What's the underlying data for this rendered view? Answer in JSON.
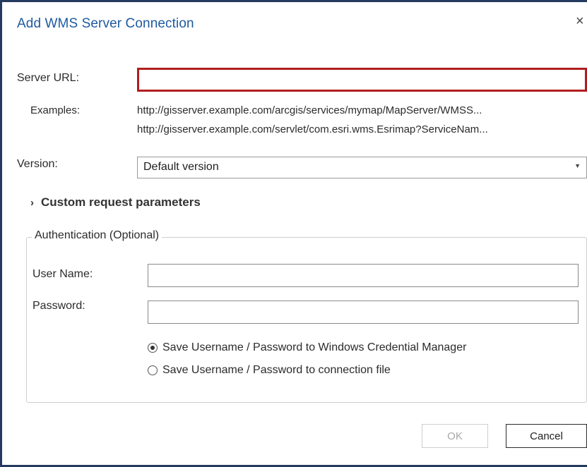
{
  "dialog": {
    "title": "Add WMS Server Connection",
    "close_glyph": "×"
  },
  "server": {
    "label": "Server URL:",
    "value": "",
    "examples_label": "Examples:",
    "examples": [
      "http://gisserver.example.com/arcgis/services/mymap/MapServer/WMSS...",
      "http://gisserver.example.com/servlet/com.esri.wms.Esrimap?ServiceNam..."
    ]
  },
  "version": {
    "label": "Version:",
    "selected": "Default version",
    "arrow_glyph": "▼"
  },
  "custom_params": {
    "chevron": "›",
    "label": "Custom request parameters"
  },
  "auth": {
    "legend": "Authentication (Optional)",
    "username_label": "User Name:",
    "username_value": "",
    "password_label": "Password:",
    "password_value": "",
    "options": [
      {
        "label": "Save Username / Password to Windows Credential Manager",
        "checked": true
      },
      {
        "label": "Save Username / Password to connection file",
        "checked": false
      }
    ]
  },
  "buttons": {
    "ok": "OK",
    "cancel": "Cancel"
  },
  "colors": {
    "title": "#1e5aa0",
    "focus_border": "#b01e1e",
    "window_border": "#243a5e"
  },
  "icons": {
    "close": "close-icon",
    "dropdown": "chevron-down-icon",
    "expander": "chevron-right-icon"
  }
}
